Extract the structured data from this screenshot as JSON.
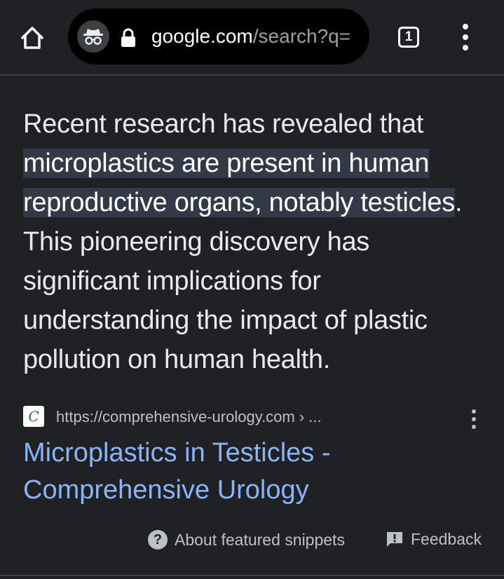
{
  "browser": {
    "url_host": "google.com",
    "url_path": "/search?q=",
    "tab_count": "1",
    "icons": {
      "home": "home-icon",
      "incognito": "incognito-icon",
      "lock": "lock-icon",
      "tabs": "tab-switcher-icon",
      "menu": "more-vert-icon"
    }
  },
  "featured_snippet": {
    "text_before": "Recent research has revealed that ",
    "highlighted": "microplastics are present in human reproductive organs, notably testicles",
    "text_after": ". This pioneering discovery has significant implications for understanding the impact of plastic pollution on human health.",
    "source_url": "https://comprehensive-urology.com › ...",
    "favicon_letter": "C",
    "result_title": "Microplastics in Testicles - Comprehensive Urology"
  },
  "footer": {
    "about_label": "About featured snippets",
    "feedback_label": "Feedback"
  },
  "colors": {
    "background": "#202124",
    "link": "#8ab4f8",
    "highlight": "#333a47",
    "text": "#e8eaed",
    "muted": "#bdc1c6"
  }
}
